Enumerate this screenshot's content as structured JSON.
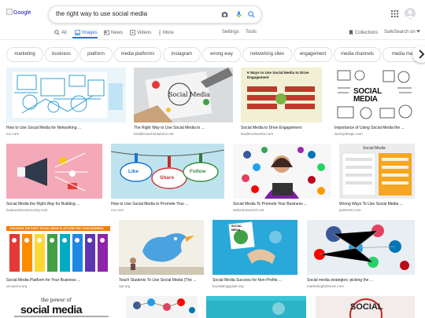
{
  "header": {
    "logo_alt": "Google",
    "query": "the right way to use social media",
    "icons": [
      "camera-icon",
      "mic-icon",
      "search-icon",
      "apps-icon",
      "avatar"
    ]
  },
  "tabs": {
    "all": "All",
    "images": "Images",
    "news": "News",
    "videos": "Videos",
    "more": "More",
    "settings": "Settings",
    "tools": "Tools",
    "collections": "Collections",
    "safesearch": "SafeSearch on"
  },
  "chips": [
    "marketing",
    "business",
    "platform",
    "media platforms",
    "instagram",
    "wrong way",
    "networking sites",
    "engagement",
    "media channels",
    "media mar"
  ],
  "results": [
    {
      "title": "How to Use Social Media for Networking ...",
      "source": "mc.com"
    },
    {
      "title": "The Right Way to Use Social Media to ...",
      "source": "healthcoachsolutions.net"
    },
    {
      "title": "Social Media to Drive Engagement",
      "source": "leadernetworks.com"
    },
    {
      "title": "Importance of Using Social Media the ...",
      "source": "aechydesign.com"
    },
    {
      "title": "Social Media the Right Way for Building ...",
      "source": "business2community.com"
    },
    {
      "title": "How to Use Social Media to Promote Your ...",
      "source": "mc.com"
    },
    {
      "title": "Social Media To Promote Your Business ...",
      "source": "webzanzsearch.net"
    },
    {
      "title": "Wrong Ways To Use Social Media ...",
      "source": "pinterest.com"
    },
    {
      "title": "Social Media Platform for Your Business ...",
      "source": "us.ascira.org"
    },
    {
      "title": "Teach Students To Use Social Media (The ...",
      "source": "npr.org"
    },
    {
      "title": "Social Media Success for Non-Profits ...",
      "source": "fourdatingguide.org"
    },
    {
      "title": "Social media strategies: picking the ...",
      "source": "marketingforlmore.com"
    }
  ],
  "thumb_text": {
    "r2": "Social Media",
    "r3": "6 Ways to Use Social Media to Drive Engagement",
    "r4": "SOCIAL MEDIA",
    "r6a": "Like",
    "r6b": "Share",
    "r6c": "Follow",
    "r8": "Social Media",
    "r9": "CHOOSING THE RIGHT SOCIAL MEDIA PLATFORM FOR YOUR BUSINESS",
    "r11": "SOCIAL MEDIA",
    "r13a": "the power of",
    "r13b": "social media",
    "r16": "SOCIAL"
  },
  "colors": {
    "accent": "#1a73e8",
    "link": "#1a0dab",
    "muted": "#70757a",
    "border": "#dfe1e5"
  }
}
